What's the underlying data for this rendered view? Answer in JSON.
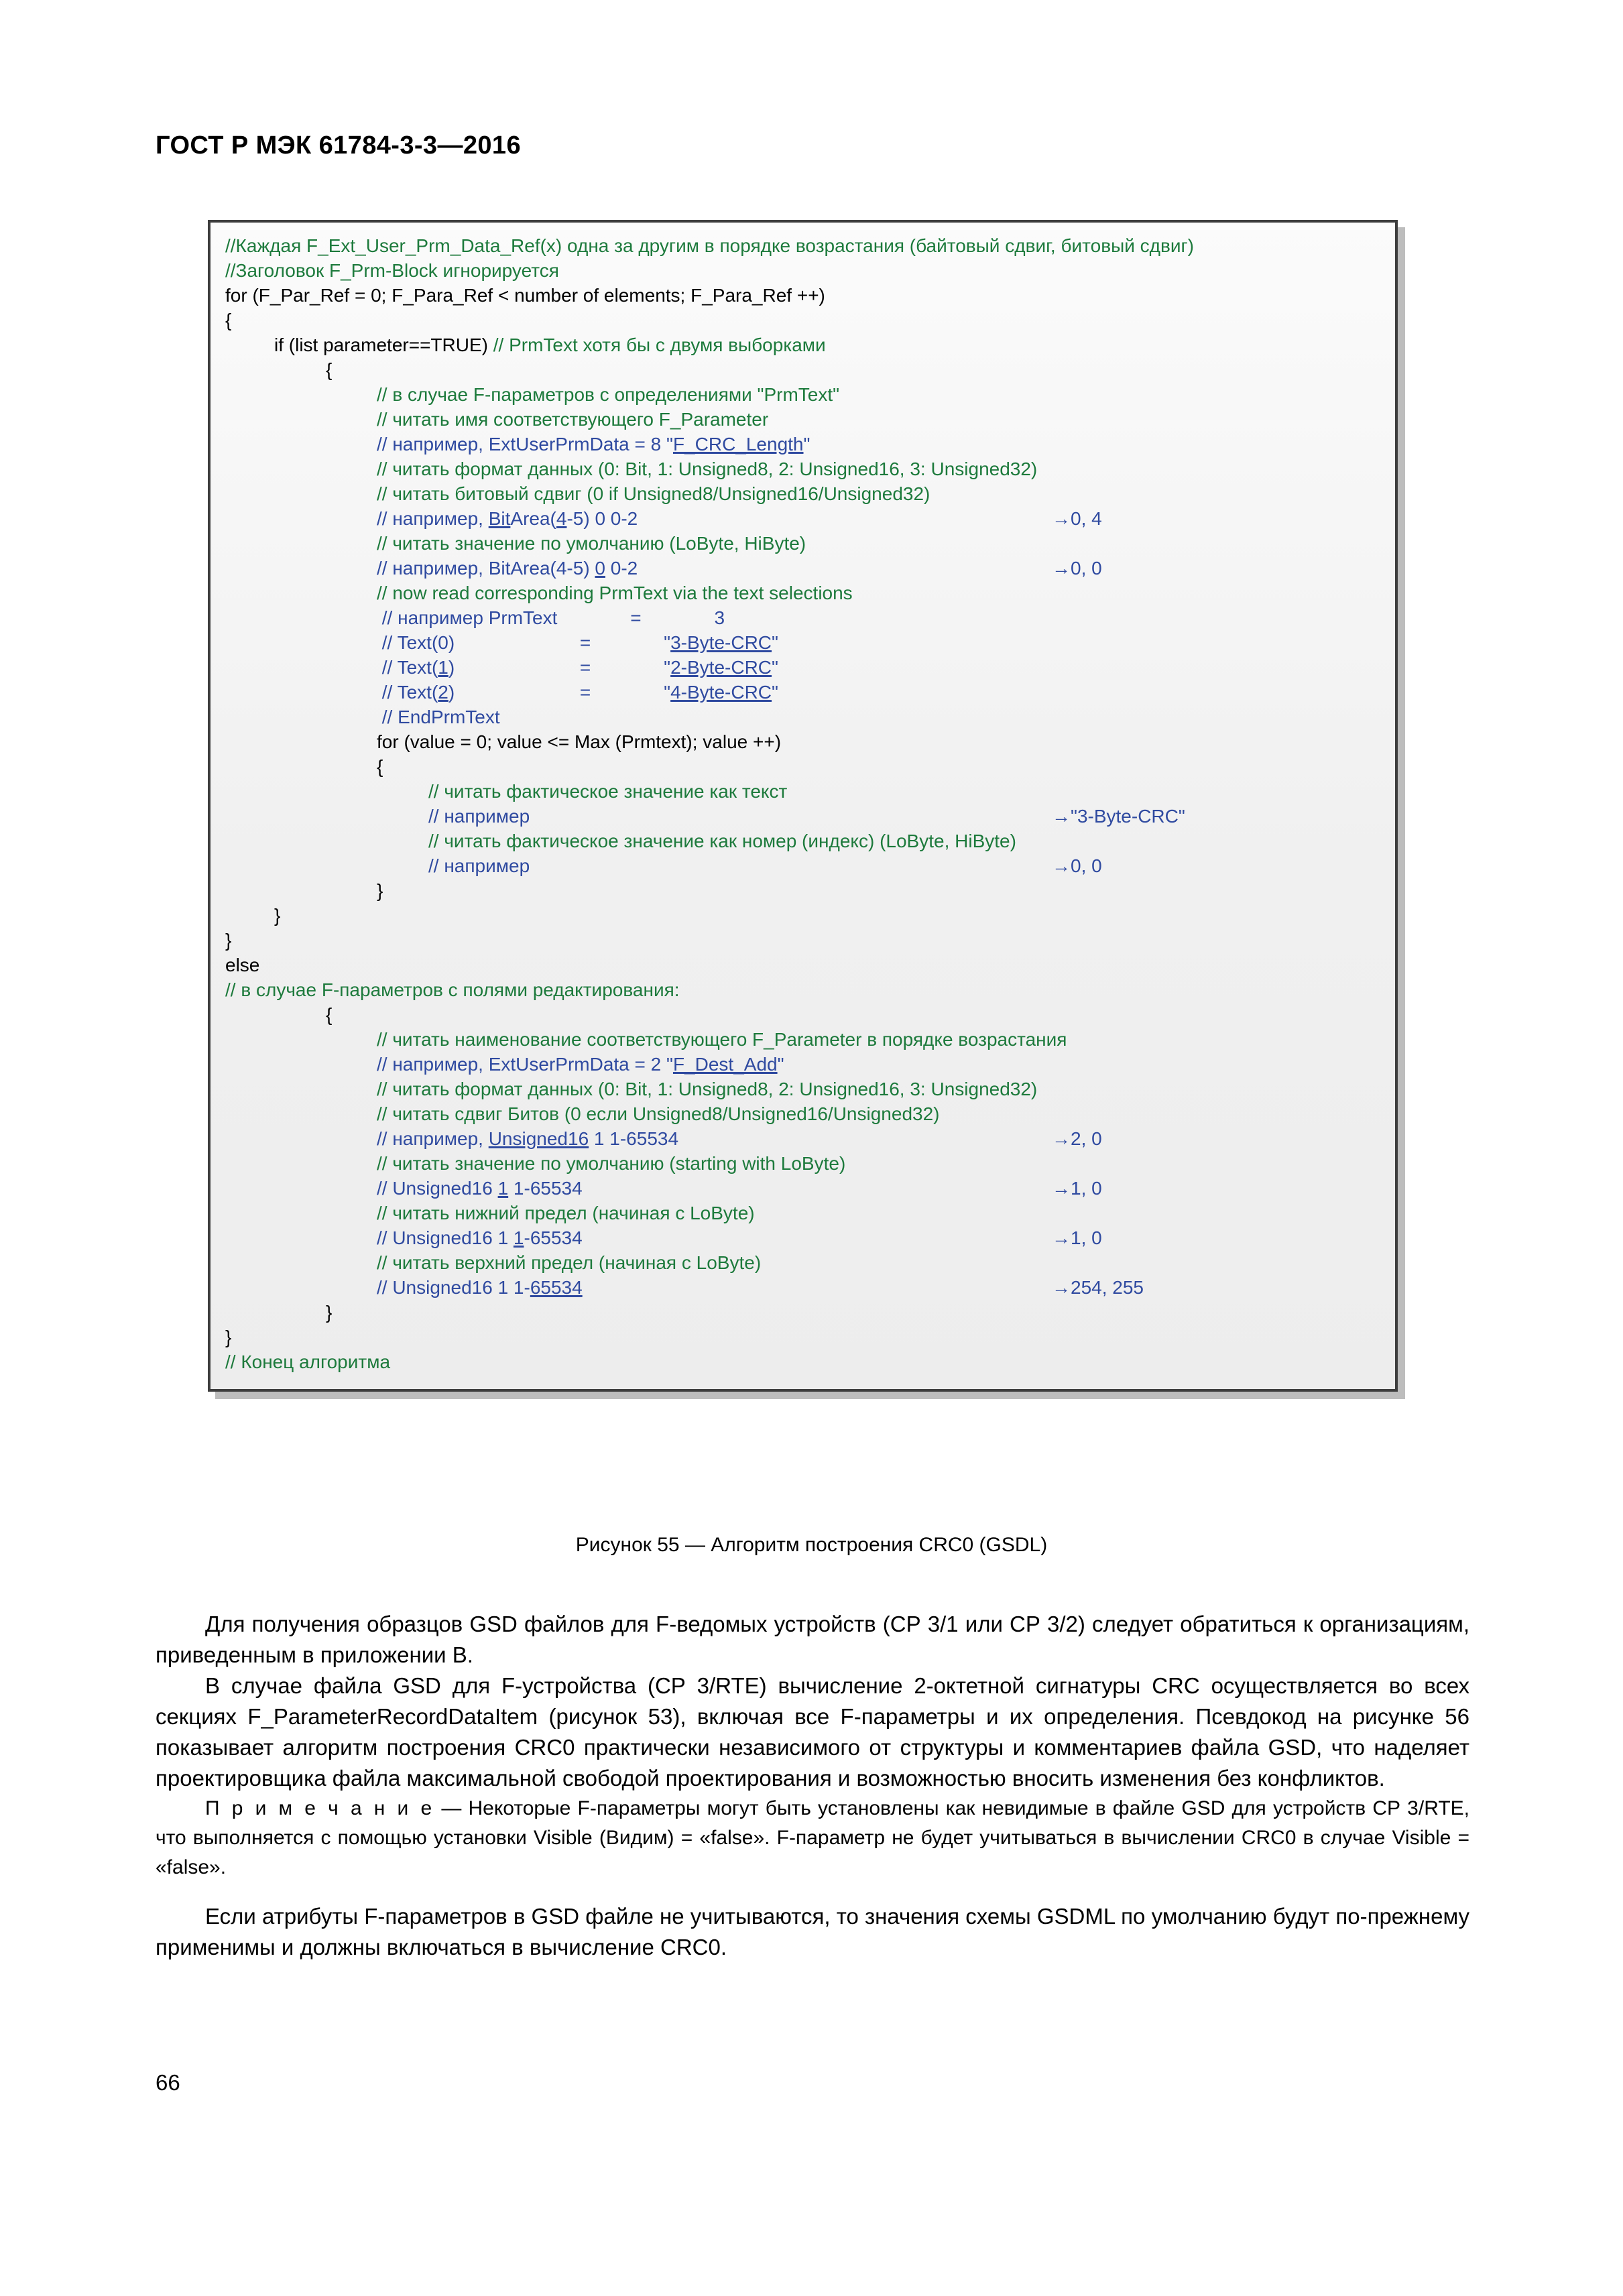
{
  "header": {
    "title": "ГОСТ Р МЭК 61784-3-3—2016"
  },
  "figure": {
    "caption": "Рисунок 55 — Алгоритм построения CRC0 (GSDL)",
    "code_lines": [
      {
        "indent": 0,
        "color": "green",
        "text": "//Каждая F_Ext_User_Prm_Data_Ref(x) одна за другим в порядке возрастания (байтовый сдвиг, битовый сдвиг)",
        "right": ""
      },
      {
        "indent": 0,
        "color": "green",
        "text": "//Заголовок F_Prm-Block игнорируется",
        "right": ""
      },
      {
        "indent": 0,
        "color": "black",
        "text": "for (F_Par_Ref = 0; F_Para_Ref < number of elements; F_Para_Ref ++)",
        "right": ""
      },
      {
        "indent": 0,
        "color": "black",
        "text": "{",
        "right": ""
      },
      {
        "indent": 1,
        "color": "black",
        "text": "if (list parameter==TRUE) ",
        "text2": "// PrmText хотя бы с двумя выборками",
        "color2": "green",
        "right": ""
      },
      {
        "indent": 2,
        "color": "black",
        "text": "{",
        "right": ""
      },
      {
        "indent": 3,
        "color": "green",
        "text": "// в случае F-параметров с определениями \"PrmText\"",
        "right": ""
      },
      {
        "indent": 3,
        "color": "green",
        "text": "// читать имя соответствующего F_Parameter",
        "right": ""
      },
      {
        "indent": 3,
        "color": "blue",
        "text": "// например, ExtUserPrmData = 8 \"",
        "underline": "F_CRC_Length",
        "text_after": "\"",
        "right": ""
      },
      {
        "indent": 3,
        "color": "green",
        "text": "// читать формат данных (0: Bit, 1: Unsigned8, 2: Unsigned16, 3: Unsigned32)",
        "right": ""
      },
      {
        "indent": 3,
        "color": "green",
        "text": "// читать битовый сдвиг (0 if Unsigned8/Unsigned16/Unsigned32)",
        "right": ""
      },
      {
        "indent": 3,
        "color": "blue",
        "text": "// например, ",
        "underline": "Bit",
        "text_after": "Area(",
        "underline2": "4",
        "text_after2": "-5) 0 0-2",
        "right": "→0, 4"
      },
      {
        "indent": 3,
        "color": "green",
        "text": "// читать значение по умолчанию (LoByte, HiByte)",
        "right": ""
      },
      {
        "indent": 3,
        "color": "blue",
        "text": "// например, BitArea(4-5) ",
        "underline": "0",
        "text_after": " 0-2",
        "right": "→0, 0"
      },
      {
        "indent": 3,
        "color": "green",
        "text": "// now read corresponding PrmText via the text selections",
        "right": ""
      },
      {
        "indent": 3,
        "color": "blue",
        "text": " // например PrmText              =              3",
        "right": ""
      },
      {
        "indent": 3,
        "color": "blue",
        "text": " // Text(0)                        =              \"",
        "underline": "3-Byte-CRC",
        "text_after": "\"",
        "right": ""
      },
      {
        "indent": 3,
        "color": "blue",
        "text": " // Text(",
        "underline": "1",
        "text_after": ")                        =              \"",
        "underline2": "2-Byte-CRC",
        "text_after2": "\"",
        "right": ""
      },
      {
        "indent": 3,
        "color": "blue",
        "text": " // Text(",
        "underline": "2",
        "text_after": ")                        =              \"",
        "underline2": "4-Byte-CRC",
        "text_after2": "\"",
        "right": ""
      },
      {
        "indent": 3,
        "color": "blue",
        "text": " // EndPrmText",
        "right": ""
      },
      {
        "indent": 3,
        "color": "black",
        "text": "for (value = 0; value <= Max (Prmtext); value ++)",
        "right": ""
      },
      {
        "indent": 3,
        "color": "black",
        "text": "{",
        "right": ""
      },
      {
        "indent": 4,
        "color": "green",
        "text": "// читать фактическое значение как текст",
        "right": ""
      },
      {
        "indent": 4,
        "color": "blue",
        "text": "// например",
        "right": "→\"3-Byte-CRC\""
      },
      {
        "indent": 4,
        "color": "green",
        "text": "// читать фактическое значение как номер (индекс) (LoByte, HiByte)",
        "right": ""
      },
      {
        "indent": 4,
        "color": "blue",
        "text": "// например",
        "right": "→0, 0"
      },
      {
        "indent": 3,
        "color": "black",
        "text": "}",
        "right": ""
      },
      {
        "indent": 1,
        "color": "black",
        "text": "}",
        "right": ""
      },
      {
        "indent": 0,
        "color": "black",
        "text": "}",
        "right": ""
      },
      {
        "indent": 0,
        "color": "black",
        "text": "else",
        "right": ""
      },
      {
        "indent": 0,
        "color": "green",
        "text": "// в случае F-параметров с полями редактирования:",
        "right": ""
      },
      {
        "indent": 2,
        "color": "black",
        "text": "{",
        "right": ""
      },
      {
        "indent": 3,
        "color": "green",
        "text": "// читать наименование соответствующего F_Parameter в порядке возрастания",
        "right": ""
      },
      {
        "indent": 3,
        "color": "blue",
        "text": "// например, ExtUserPrmData = 2 \"",
        "underline": "F_Dest_Add",
        "text_after": "\"",
        "right": ""
      },
      {
        "indent": 3,
        "color": "green",
        "text": "// читать формат данных (0: Bit, 1: Unsigned8, 2: Unsigned16, 3: Unsigned32)",
        "right": ""
      },
      {
        "indent": 3,
        "color": "green",
        "text": "// читать сдвиг Битов (0 если Unsigned8/Unsigned16/Unsigned32)",
        "right": ""
      },
      {
        "indent": 3,
        "color": "blue",
        "text": "// например, ",
        "underline": "Unsigned16",
        "text_after": " 1 1-65534",
        "right": "→2, 0"
      },
      {
        "indent": 3,
        "color": "green",
        "text": "// читать значение по умолчанию (starting with LoByte)",
        "right": ""
      },
      {
        "indent": 3,
        "color": "blue",
        "text": "// Unsigned16 ",
        "underline": "1",
        "text_after": " 1-65534",
        "right": "→1, 0"
      },
      {
        "indent": 3,
        "color": "green",
        "text": "// читать нижний предел (начиная с LoByte)",
        "right": ""
      },
      {
        "indent": 3,
        "color": "blue",
        "text": "// Unsigned16 1 ",
        "underline": "1",
        "text_after": "-65534",
        "right": "→1, 0"
      },
      {
        "indent": 3,
        "color": "green",
        "text": "// читать верхний предел (начиная с LoByte)",
        "right": ""
      },
      {
        "indent": 3,
        "color": "blue",
        "text": "// Unsigned16 1 1-",
        "underline": "65534",
        "text_after": "",
        "right": "→254, 255"
      },
      {
        "indent": 2,
        "color": "black",
        "text": "}",
        "right": ""
      },
      {
        "indent": 0,
        "color": "black",
        "text": "}",
        "right": ""
      },
      {
        "indent": 0,
        "color": "green",
        "text": "// Конец алгоритма",
        "right": ""
      }
    ]
  },
  "body": {
    "paragraphs": [
      "Для получения образцов GSD файлов для F-ведомых устройств (СР 3/1 или СР 3/2) следует обратиться к организациям, приведенным в приложении В.",
      "В случае файла GSD для F-устройства (СР 3/RTE) вычисление 2-октетной сигнатуры CRC осуществляется во всех секциях F_ParameterRecordDataItem (рисунок 53), включая все F-параметры и их определения. Псевдокод на рисунке 56 показывает алгоритм построения CRC0 практически независимого от структуры и комментариев файла GSD, что наделяет проектировщика файла максимальной свободой проектирования и возможностью вносить изменения без конфликтов."
    ],
    "note_label": "П р и м е ч а н и е",
    "note_text": " — Некоторые F-параметры могут быть установлены как невидимые в файле GSD для устройств СР 3/RTE, что выполняется с помощью установки Visible (Видим) = «false». F-параметр не будет учитываться в вычислении CRC0 в случае Visible = «false».",
    "last_paragraph": "Если атрибуты F-параметров в GSD файле не учитываются, то значения схемы GSDML по умолчанию будут по-прежнему применимы и должны включаться в вычисление CRC0."
  },
  "page_number": "66",
  "colors": {
    "comment_green": "#1d7a3c",
    "example_blue": "#2f4aa0",
    "code_black": "#000000",
    "box_border": "#3d3d3d",
    "box_shadow": "#bdbdbd",
    "box_background": "#f2f2f2"
  }
}
